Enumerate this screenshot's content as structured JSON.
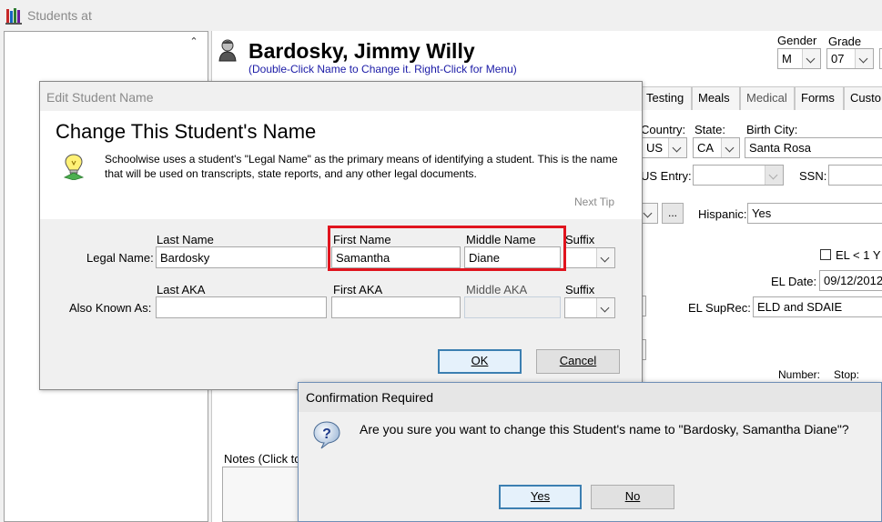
{
  "window": {
    "title": "Students at"
  },
  "student": {
    "name": "Bardosky, Jimmy Willy",
    "hint": "(Double-Click Name to Change it. Right-Click for Menu)"
  },
  "header_fields": {
    "gender_label": "Gender",
    "gender_value": "M",
    "grade_label": "Grade",
    "grade_value": "07"
  },
  "tabs": [
    "Testing",
    "Meals",
    "Medical",
    "Forms",
    "Custo"
  ],
  "demographics": {
    "country_label": "Country:",
    "country_value": "US",
    "state_label": "State:",
    "state_value": "CA",
    "birth_city_label": "Birth City:",
    "birth_city_value": "Santa Rosa",
    "us_entry_label": "US Entry:",
    "ssn_label": "SSN:",
    "ellipsis_label": "...",
    "hispanic_label": "Hispanic:",
    "hispanic_value": "Yes",
    "el_lt1_label": "EL < 1 Y",
    "el_date_label": "EL Date:",
    "el_date_value": "09/12/2012",
    "el_suprec_label": "EL SupRec:",
    "el_suprec_value": "ELD and SDAIE",
    "number_label": "Number:",
    "stop_label": "Stop:",
    "notes_label": "Notes (Click to"
  },
  "edit_dialog": {
    "title": "Edit Student Name",
    "heading": "Change This Student's Name",
    "info": "Schoolwise uses a student's \"Legal Name\" as the primary means of identifying a student. This is the name that will be used on transcripts, state reports, and any other legal documents.",
    "next_tip": "Next Tip",
    "col_last": "Last Name",
    "col_first": "First Name",
    "col_middle": "Middle Name",
    "col_suffix": "Suffix",
    "legal_label": "Legal Name:",
    "legal_last": "Bardosky",
    "legal_first": "Samantha",
    "legal_middle": "Diane",
    "col_last_aka": "Last AKA",
    "col_first_aka": "First AKA",
    "col_middle_aka": "Middle AKA",
    "col_suffix_aka": "Suffix",
    "aka_label": "Also Known As:",
    "ok_label": "OK",
    "cancel_label": "Cancel",
    "highlight_color": "#e0141e"
  },
  "confirm_dialog": {
    "title": "Confirmation Required",
    "message": "Are you sure you want to change this Student's name to \"Bardosky, Samantha Diane\"?",
    "yes_label": "Yes",
    "no_label": "No"
  }
}
